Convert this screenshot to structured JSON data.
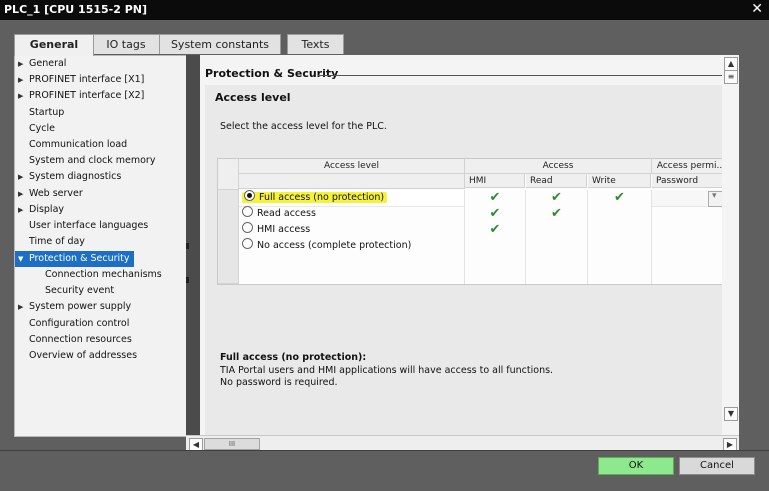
{
  "window": {
    "title": "PLC_1 [CPU 1515-2 PN]",
    "close_glyph": "✕"
  },
  "tabs": [
    {
      "label": "General",
      "active": true
    },
    {
      "label": "IO tags"
    },
    {
      "label": "System constants"
    },
    {
      "label": "Texts"
    }
  ],
  "nav": {
    "items": [
      {
        "label": "General",
        "expandable": true
      },
      {
        "label": "PROFINET interface [X1]",
        "expandable": true
      },
      {
        "label": "PROFINET interface [X2]",
        "expandable": true
      },
      {
        "label": "Startup"
      },
      {
        "label": "Cycle"
      },
      {
        "label": "Communication load"
      },
      {
        "label": "System and clock memory"
      },
      {
        "label": "System diagnostics",
        "expandable": true
      },
      {
        "label": "Web server",
        "expandable": true
      },
      {
        "label": "Display",
        "expandable": true
      },
      {
        "label": "User interface languages"
      },
      {
        "label": "Time of day"
      },
      {
        "label": "Protection & Security",
        "expanded": true,
        "selected": true
      },
      {
        "label": "Connection mechanisms",
        "child": true
      },
      {
        "label": "Security event",
        "child": true
      },
      {
        "label": "System power supply",
        "expandable": true
      },
      {
        "label": "Configuration control"
      },
      {
        "label": "Connection resources"
      },
      {
        "label": "Overview of addresses"
      }
    ]
  },
  "content": {
    "section_title": "Protection & Security",
    "subsection_title": "Access level",
    "description": "Select the access level for the PLC.",
    "table": {
      "header_groups": {
        "access_level": "Access level",
        "access": "Access",
        "access_permission": "Access permi..."
      },
      "subheaders": {
        "hmi": "HMI",
        "read": "Read",
        "write": "Write",
        "password": "Password"
      },
      "rows": [
        {
          "label": "Full access (no protection)",
          "selected": true,
          "hmi": true,
          "read": true,
          "write": true
        },
        {
          "label": "Read access",
          "selected": false,
          "hmi": true,
          "read": true,
          "write": false
        },
        {
          "label": "HMI access",
          "selected": false,
          "hmi": true,
          "read": false,
          "write": false
        },
        {
          "label": "No access (complete protection)",
          "selected": false,
          "hmi": false,
          "read": false,
          "write": false
        }
      ],
      "check_glyph": "✔"
    },
    "info": {
      "title": "Full access (no protection):",
      "line1": "TIA Portal users and HMI applications will have access to all functions.",
      "line2": "No password is required."
    }
  },
  "scrollbar": {
    "thumb_label": "III"
  },
  "buttons": {
    "ok": "OK",
    "cancel": "Cancel"
  },
  "colors": {
    "selection": "#1d6fc6",
    "highlight": "#f6f23c",
    "ok_button": "#8ee88c",
    "check": "#2e8b2e"
  }
}
